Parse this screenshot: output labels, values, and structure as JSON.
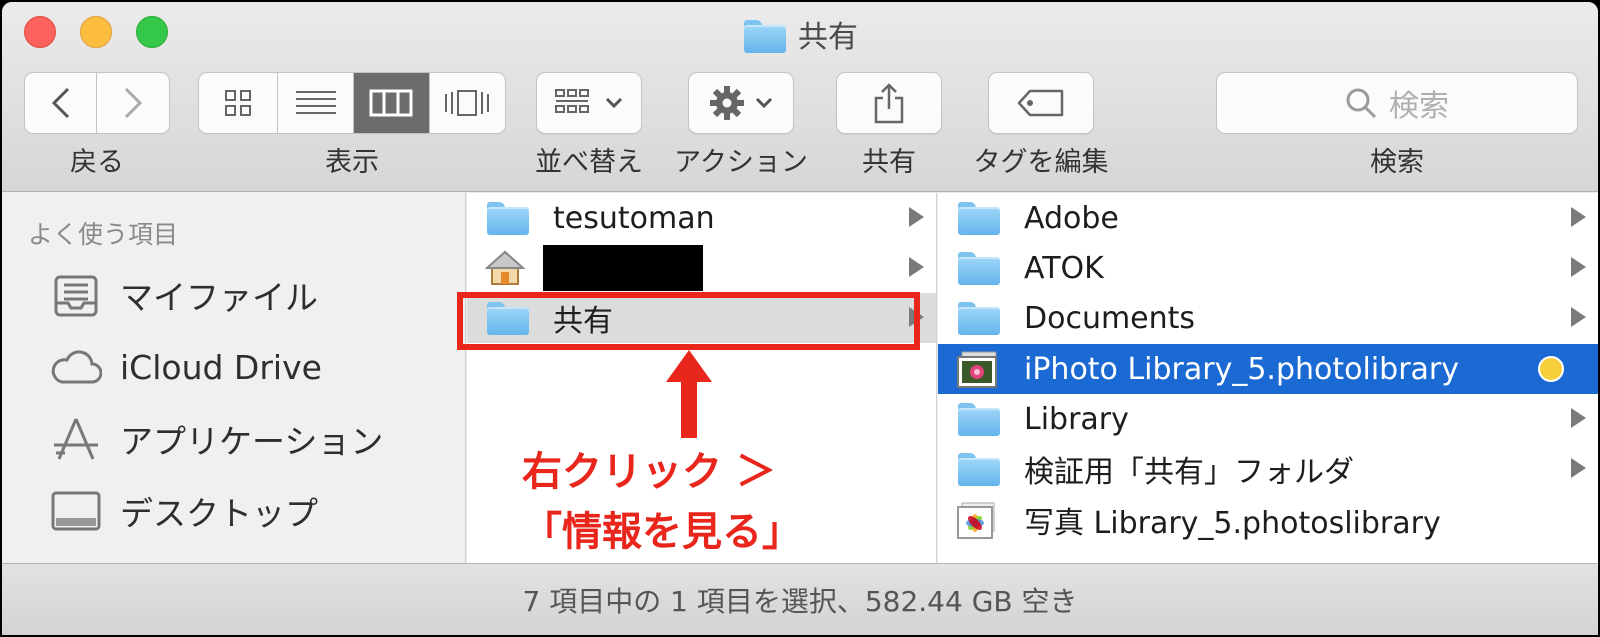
{
  "window": {
    "title": "共有"
  },
  "toolbar": {
    "back_label": "戻る",
    "view_label": "表示",
    "sort_label": "並べ替え",
    "action_label": "アクション",
    "share_label": "共有",
    "tag_label": "タグを編集",
    "search_label": "検索",
    "search_placeholder": "検索",
    "active_view": "column"
  },
  "sidebar": {
    "heading": "よく使う項目",
    "items": [
      {
        "label": "マイファイル",
        "icon": "all-my-files-icon"
      },
      {
        "label": "iCloud Drive",
        "icon": "cloud-icon"
      },
      {
        "label": "アプリケーション",
        "icon": "applications-icon"
      },
      {
        "label": "デスクトップ",
        "icon": "desktop-icon"
      }
    ]
  },
  "column1": {
    "items": [
      {
        "label": "tesutoman",
        "icon": "folder-icon",
        "has_children": true
      },
      {
        "label": "",
        "icon": "home-icon",
        "redacted": true,
        "has_children": true
      },
      {
        "label": "共有",
        "icon": "folder-icon",
        "selected": true,
        "has_children": true
      }
    ]
  },
  "column2": {
    "items": [
      {
        "label": "Adobe",
        "icon": "folder-icon",
        "has_children": true
      },
      {
        "label": "ATOK",
        "icon": "folder-icon",
        "has_children": true
      },
      {
        "label": "Documents",
        "icon": "folder-icon",
        "has_children": true
      },
      {
        "label": "iPhoto Library_5.photolibrary",
        "icon": "iphoto-library-icon",
        "selected": true,
        "tag_color": "#f7cf3d"
      },
      {
        "label": "Library",
        "icon": "folder-icon",
        "has_children": true
      },
      {
        "label": "検証用「共有」フォルダ",
        "icon": "folder-icon",
        "has_children": true
      },
      {
        "label": "写真 Library_5.photoslibrary",
        "icon": "photos-library-icon"
      }
    ]
  },
  "annotation": {
    "line1": "右クリック ＞",
    "line2": "「情報を見る」",
    "color": "#e8261c"
  },
  "status": {
    "text": "7 項目中の 1 項目を選択、582.44 GB 空き"
  },
  "colors": {
    "selection_blue": "#1b6ad3",
    "selection_gray": "#dcdcdc",
    "accent_red": "#e8261c"
  }
}
